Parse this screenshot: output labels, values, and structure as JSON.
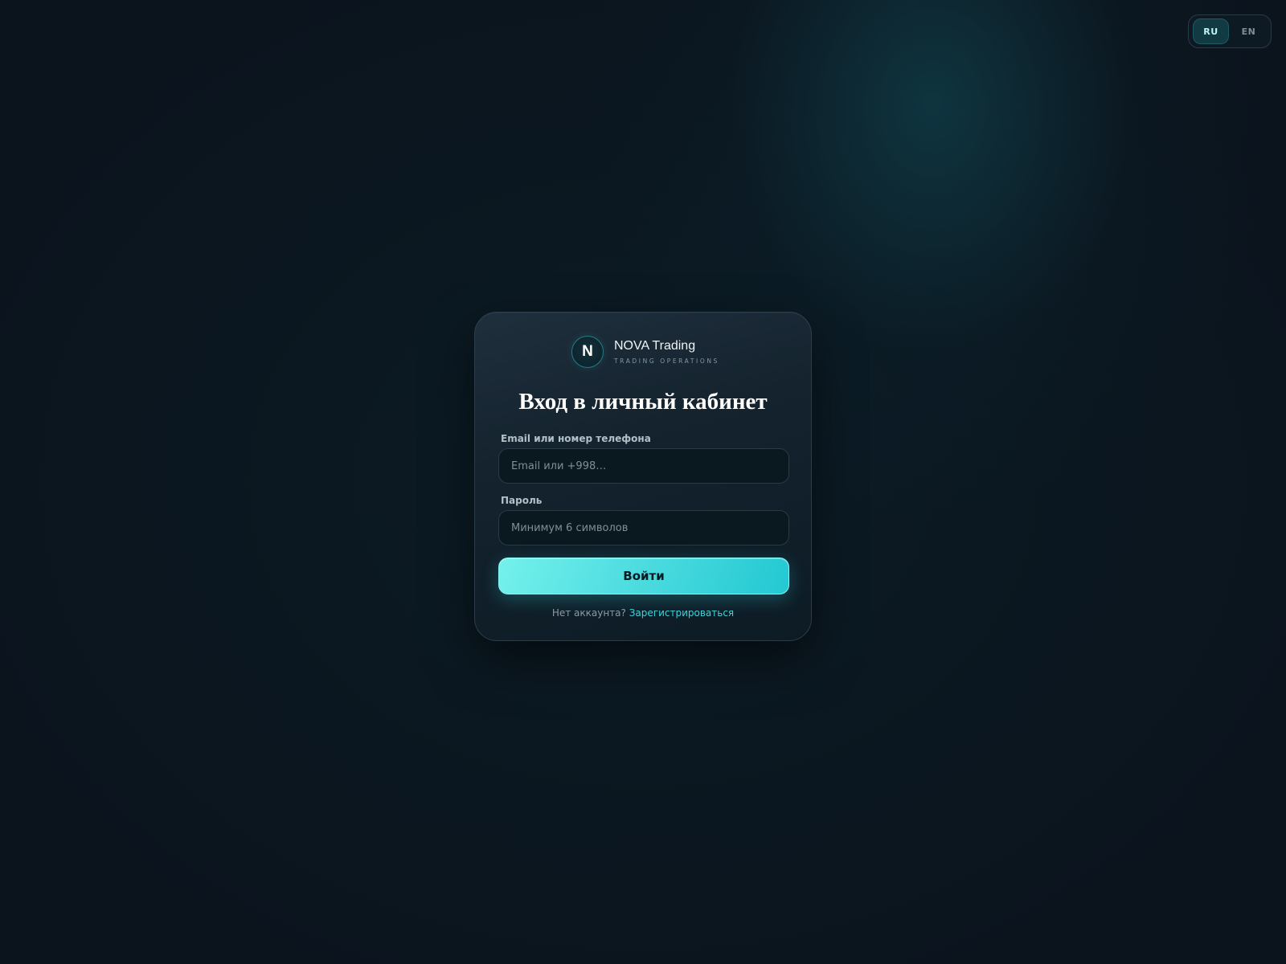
{
  "language_switcher": {
    "options": [
      {
        "code": "RU",
        "active": true
      },
      {
        "code": "EN",
        "active": false
      }
    ]
  },
  "brand": {
    "logo_letter": "N",
    "name": "NOVA Trading",
    "tagline": "TRADING OPERATIONS"
  },
  "login_form": {
    "title": "Вход в личный кабинет",
    "email_label": "Email или номер телефона",
    "email_placeholder": "Email или +998…",
    "email_value": "",
    "password_label": "Пароль",
    "password_placeholder": "Минимум 6 символов",
    "password_value": "",
    "submit_label": "Войти",
    "no_account_text": "Нет аккаунта?",
    "register_link": "Зарегистрироваться"
  },
  "colors": {
    "accent": "#3fd3d8",
    "button_gradient_start": "#74f1ec",
    "button_gradient_end": "#23c8d2",
    "background": "#0b151e"
  }
}
